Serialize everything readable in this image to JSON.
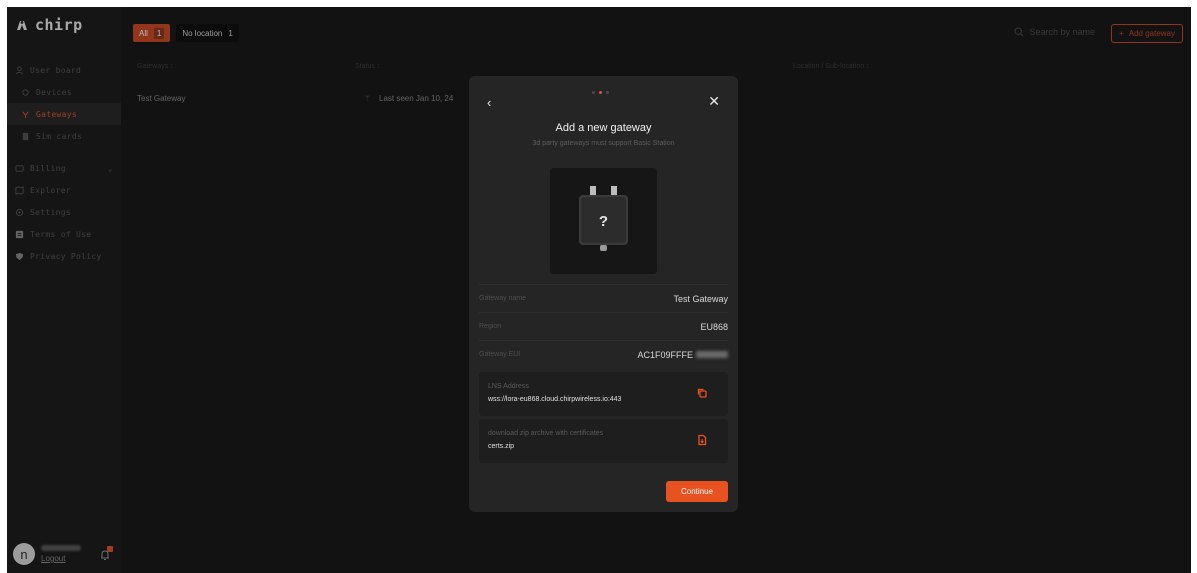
{
  "app": {
    "logo_text": "chirp"
  },
  "sidebar": {
    "items": [
      {
        "label": "User board",
        "icon": "user-icon"
      },
      {
        "label": "Devices",
        "icon": "devices-icon"
      },
      {
        "label": "Gateways",
        "icon": "gateway-icon",
        "active": true
      },
      {
        "label": "Sim cards",
        "icon": "sim-icon"
      },
      {
        "label": "Billing",
        "icon": "billing-icon"
      },
      {
        "label": "Explorer",
        "icon": "explorer-icon"
      },
      {
        "label": "Settings",
        "icon": "settings-icon"
      },
      {
        "label": "Terms of Use",
        "icon": "document-icon"
      },
      {
        "label": "Privacy Policy",
        "icon": "shield-icon"
      }
    ],
    "user": {
      "avatar_initial": "n",
      "logout_label": "Logout"
    }
  },
  "toolbar": {
    "filter_all_label": "All",
    "filter_all_count": "1",
    "filter_noloc_label": "No location",
    "filter_noloc_count": "1",
    "search_placeholder": "Search by name",
    "add_label": "Add gateway"
  },
  "table": {
    "columns": [
      "Gateways ↕",
      "Status ↕",
      "Location / Sub-location ↕"
    ],
    "rows": [
      {
        "name": "Test Gateway",
        "status": "Last seen Jan 10, 24"
      }
    ]
  },
  "modal": {
    "title": "Add a new gateway",
    "subtitle": "3d party gateways must support Basic Station",
    "fields": [
      {
        "label": "Gateway name",
        "value": "Test Gateway"
      },
      {
        "label": "Region",
        "value": "EU868"
      },
      {
        "label": "Gateway EUI",
        "value": "AC1F09FFFE"
      }
    ],
    "lns": {
      "label": "LNS Address",
      "value": "wss://lora-eu868.cloud.chirpwireless.io:443"
    },
    "certs": {
      "label": "download zip archive with certificates",
      "value": "certs.zip"
    },
    "continue_label": "Continue"
  },
  "colors": {
    "accent": "#e85120",
    "background": "#191919",
    "modal": "#252525"
  }
}
